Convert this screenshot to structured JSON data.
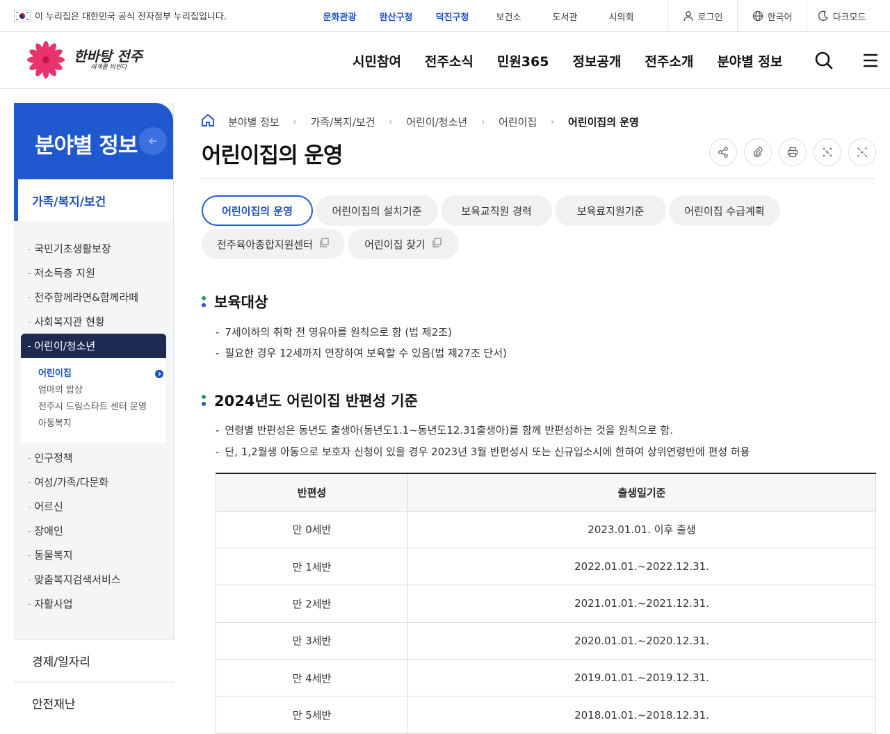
{
  "topbar": {
    "gov_notice": "이 누리집은 대한민국 공식 전자정부 누리집입니다.",
    "links": [
      {
        "label": "문화관광",
        "highlight": true
      },
      {
        "label": "완산구청",
        "highlight": true
      },
      {
        "label": "덕진구청",
        "highlight": true
      },
      {
        "label": "보건소",
        "highlight": false
      },
      {
        "label": "도서관",
        "highlight": false
      },
      {
        "label": "시의회",
        "highlight": false
      }
    ],
    "login": "로그인",
    "language": "한국어",
    "darkmode": "다크모드"
  },
  "header": {
    "logo_main": "한바탕 전주",
    "logo_sub": "세계를 비빈다",
    "gnb": [
      "시민참여",
      "전주소식",
      "민원365",
      "정보공개",
      "전주소개",
      "분야별 정보"
    ]
  },
  "sidebar": {
    "title": "분야별 정보",
    "category": "가족/복지/보건",
    "items": [
      "국민기초생활보장",
      "저소득층 지원",
      "전주함께라면&함께라떼",
      "사회복지관 현황",
      "어린이/청소년",
      "인구정책",
      "여성/가족/다문화",
      "어르신",
      "장애인",
      "동물복지",
      "맞춤복지검색서비스",
      "자활사업"
    ],
    "active_index": 4,
    "sub": [
      "어린이집",
      "엄마의 밥상",
      "전주시 드림스타트 센터 운영",
      "아동복지"
    ],
    "bottom": [
      "경제/일자리",
      "안전재난"
    ]
  },
  "breadcrumb": [
    "분야별 정보",
    "가족/복지/보건",
    "어린이/청소년",
    "어린이집",
    "어린이집의 운영"
  ],
  "page_title": "어린이집의 운영",
  "tabs": [
    {
      "label": "어린이집의 운영",
      "active": true,
      "ext": false
    },
    {
      "label": "어린이집의 설치기준",
      "active": false,
      "ext": false
    },
    {
      "label": "보육교직원 경력",
      "active": false,
      "ext": false
    },
    {
      "label": "보육료지원기준",
      "active": false,
      "ext": false
    },
    {
      "label": "어린이집 수급계획",
      "active": false,
      "ext": false
    },
    {
      "label": "전주육아종합지원센터",
      "active": false,
      "ext": true
    },
    {
      "label": "어린이집 찾기",
      "active": false,
      "ext": true
    }
  ],
  "section1": {
    "title": "보육대상",
    "items": [
      "7세이하의 취학 전 영유아를 원칙으로 함 (법 제2조)",
      "필요한 경우 12세까지 연장하여 보육할 수 있음(법 제27조 단서)"
    ]
  },
  "section2": {
    "title": "2024년도 어린이집 반편성 기준",
    "items": [
      "연령별 반편성은 동년도 출생아(동년도1.1~동년도12.31출생아)를 함께 반편성하는 것을 원칙으로 함.",
      "단, 1,2월생 아동으로 보호자 신청이 있을 경우 2023년 3월 반편성시 또는 신규입소시에 한하여 상위연령반에 편성 허용"
    ]
  },
  "table": {
    "headers": [
      "반편성",
      "출생일기준"
    ],
    "rows": [
      [
        "만 0세반",
        "2023.01.01. 이후 출생"
      ],
      [
        "만 1세반",
        "2022.01.01.~2022.12.31."
      ],
      [
        "만 2세반",
        "2021.01.01.~2021.12.31."
      ],
      [
        "만 3세반",
        "2020.01.01.~2020.12.31."
      ],
      [
        "만 4세반",
        "2019.01.01.~2019.12.31."
      ],
      [
        "만 5세반",
        "2018.01.01.~2018.12.31."
      ]
    ]
  },
  "colors": {
    "primary": "#2059cf",
    "navy": "#1e2a52",
    "bullet_green": "#1f9a6a",
    "bullet_blue": "#2059cf"
  }
}
